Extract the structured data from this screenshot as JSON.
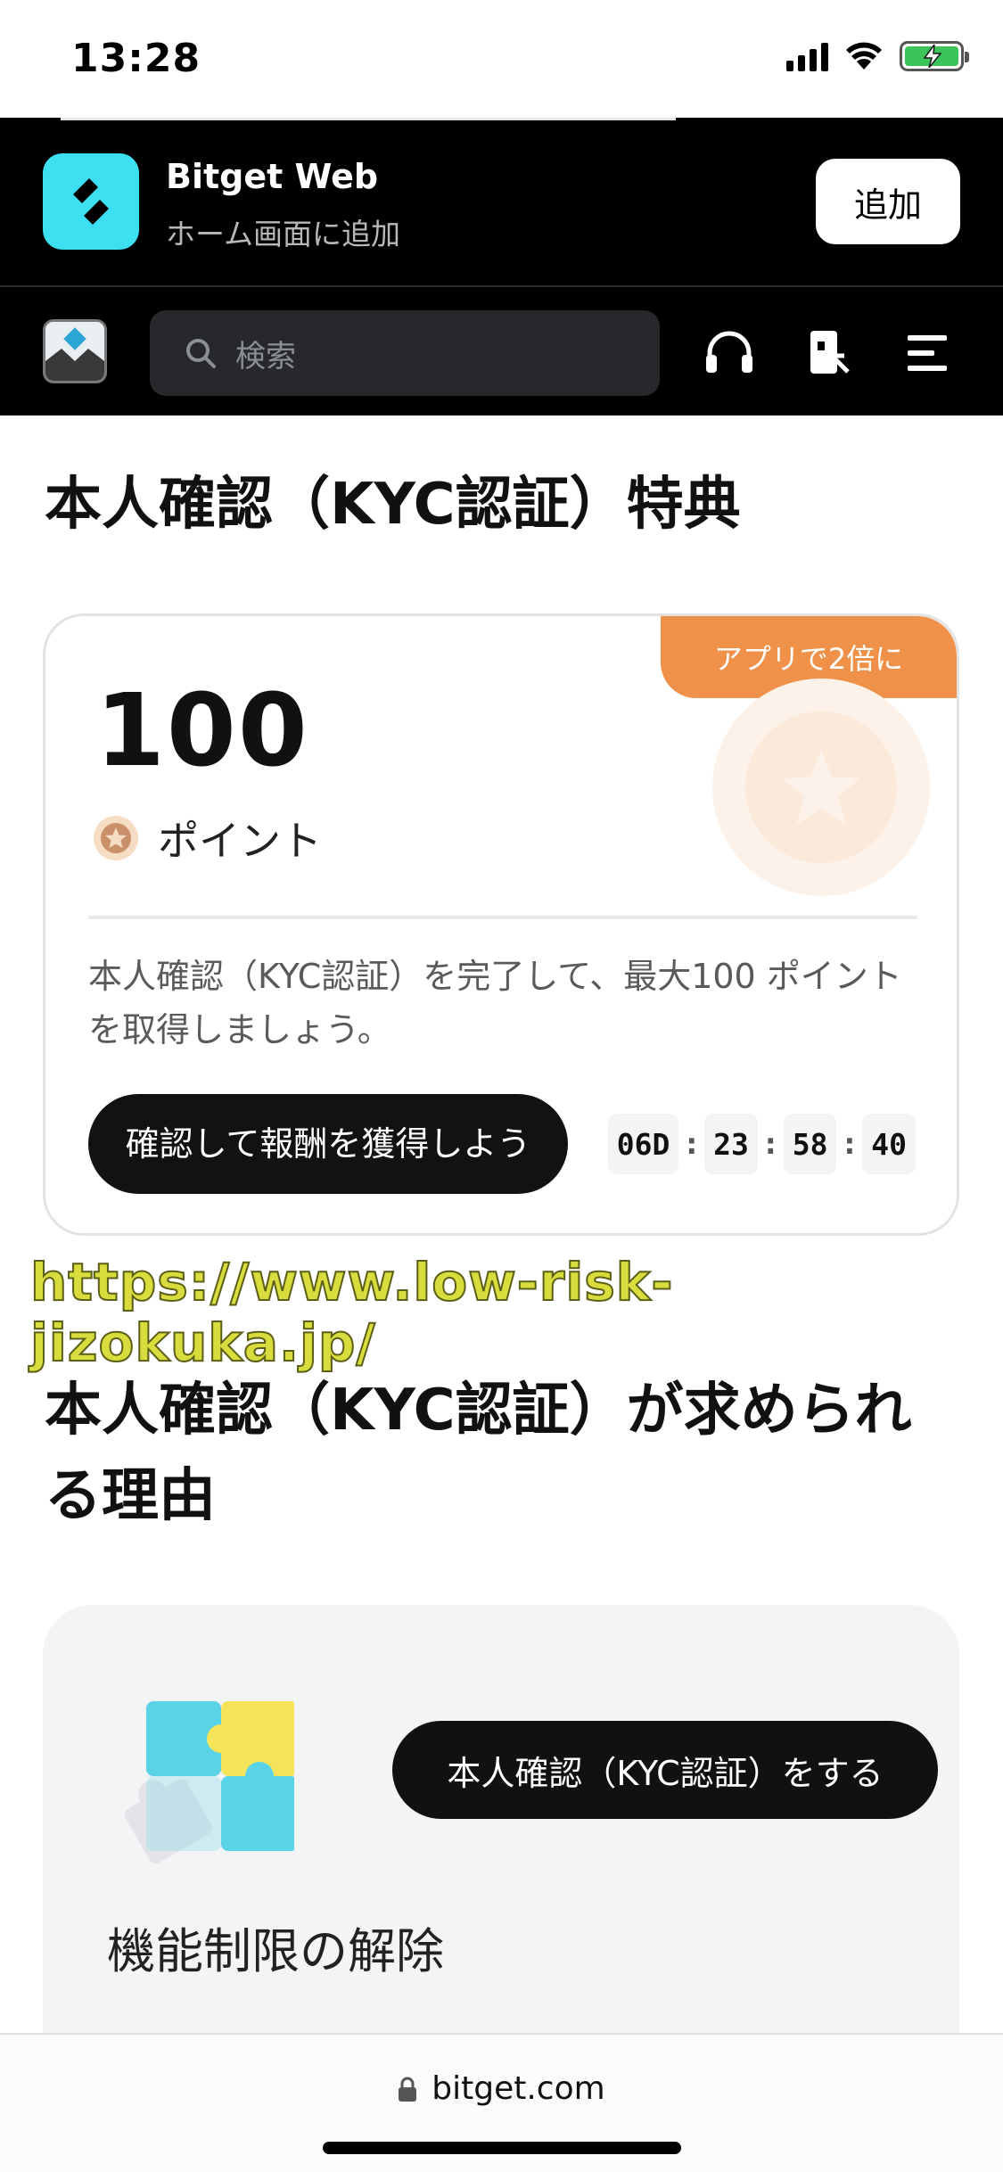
{
  "status_bar": {
    "time": "13:28"
  },
  "app_banner": {
    "app_name": "Bitget Web",
    "subtitle": "ホーム画面に追加",
    "add_label": "追加"
  },
  "nav": {
    "search_placeholder": "検索",
    "icons": [
      "headset-icon",
      "deposit-icon",
      "menu-icon"
    ]
  },
  "reward_section": {
    "title": "本人確認（KYC認証）特典",
    "badge": "アプリで2倍に",
    "points_value": "100",
    "points_label": "ポイント",
    "description": "本人確認（KYC認証）を完了して、最大100 ポイントを取得しましょう。",
    "cta_label": "確認して報酬を獲得しよう",
    "countdown": {
      "days": "06D",
      "hours": "23",
      "minutes": "58",
      "seconds": "40",
      "separator": ":"
    }
  },
  "watermark": {
    "url": "https://www.low-risk-jizokuka.jp/"
  },
  "reason_section": {
    "title": "本人確認（KYC認証）が求められる理由",
    "kyc_button_label": "本人確認（KYC認証）をする",
    "feature_title": "機能制限の解除"
  },
  "url_bar": {
    "domain": "bitget.com"
  },
  "colors": {
    "accent_orange": "#f0914a",
    "brand_cyan": "#3ce0f0",
    "dark": "#000000"
  }
}
